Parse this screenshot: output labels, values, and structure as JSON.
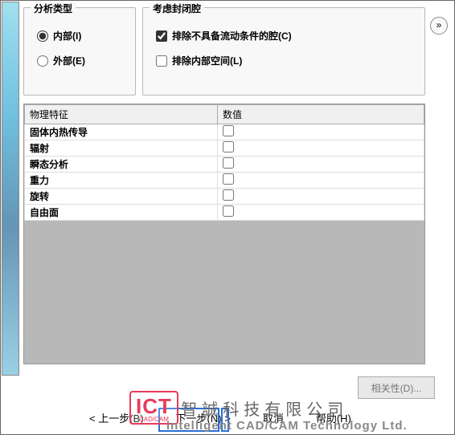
{
  "analysis_type": {
    "legend": "分析类型",
    "internal": "内部(I)",
    "external": "外部(E)"
  },
  "cavity": {
    "legend": "考虑封闭腔",
    "exclude_no_flow": "排除不具备流动条件的腔(C)",
    "exclude_internal_space": "排除内部空间(L)"
  },
  "table": {
    "col_property": "物理特征",
    "col_value": "数值",
    "rows": [
      {
        "name": "固体内热传导",
        "checked": false
      },
      {
        "name": "辐射",
        "checked": false
      },
      {
        "name": "瞬态分析",
        "checked": false
      },
      {
        "name": "重力",
        "checked": false
      },
      {
        "name": "旋转",
        "checked": false
      },
      {
        "name": "自由面",
        "checked": false
      }
    ]
  },
  "buttons": {
    "attributes": "相关性(D)...",
    "prev": "< 上一步(B)",
    "next": "下一步(N) >",
    "cancel": "取消",
    "help": "帮助(H)"
  },
  "expand_glyph": "»",
  "watermark": {
    "logo": "ICT",
    "logo_sub": "CAD/CAM",
    "cn": "智誠科技有限公司",
    "en": "Intelligent CAD/CAM Technology Ltd."
  }
}
